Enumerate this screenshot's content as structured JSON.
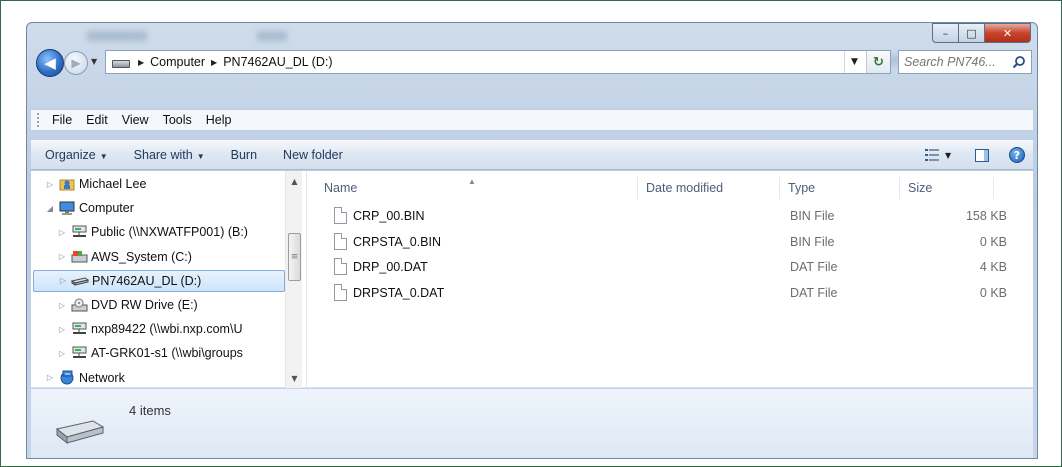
{
  "window": {
    "caption": {
      "minimize": "–",
      "maximize": "□",
      "close": "✕"
    }
  },
  "address": {
    "crumbs": [
      "Computer",
      "PN7462AU_DL (D:)"
    ],
    "search_placeholder": "Search PN746..."
  },
  "menu": [
    "File",
    "Edit",
    "View",
    "Tools",
    "Help"
  ],
  "toolbar": {
    "organize": "Organize",
    "share_with": "Share with",
    "burn": "Burn",
    "new_folder": "New folder"
  },
  "nav": [
    {
      "label": "Michael Lee",
      "icon": "user-folder-icon",
      "expander": "▷",
      "indent": 1
    },
    {
      "label": "Computer",
      "icon": "computer-icon",
      "expander": "◢",
      "indent": 1
    },
    {
      "label": "Public (\\\\NXWATFP001) (B:)",
      "icon": "network-drive-icon",
      "expander": "▷",
      "indent": 2
    },
    {
      "label": "AWS_System (C:)",
      "icon": "system-drive-icon",
      "expander": "▷",
      "indent": 2
    },
    {
      "label": "PN7462AU_DL (D:)",
      "icon": "removable-drive-icon",
      "expander": "▷",
      "indent": 2,
      "selected": true
    },
    {
      "label": "DVD RW Drive (E:)",
      "icon": "dvd-drive-icon",
      "expander": "▷",
      "indent": 2
    },
    {
      "label": "nxp89422 (\\\\wbi.nxp.com\\U",
      "icon": "network-drive-icon",
      "expander": "▷",
      "indent": 2
    },
    {
      "label": "AT-GRK01-s1 (\\\\wbi\\groups",
      "icon": "network-drive-icon",
      "expander": "▷",
      "indent": 2
    },
    {
      "label": "Network",
      "icon": "network-icon",
      "expander": "▷",
      "indent": 1
    }
  ],
  "columns": {
    "name": "Name",
    "date_modified": "Date modified",
    "type": "Type",
    "size": "Size"
  },
  "files": [
    {
      "name": "CRP_00.BIN",
      "type": "BIN File",
      "size": "158 KB"
    },
    {
      "name": "CRPSTA_0.BIN",
      "type": "BIN File",
      "size": "0 KB"
    },
    {
      "name": "DRP_00.DAT",
      "type": "DAT File",
      "size": "4 KB"
    },
    {
      "name": "DRPSTA_0.DAT",
      "type": "DAT File",
      "size": "0 KB"
    }
  ],
  "details": {
    "item_count": "4 items"
  }
}
